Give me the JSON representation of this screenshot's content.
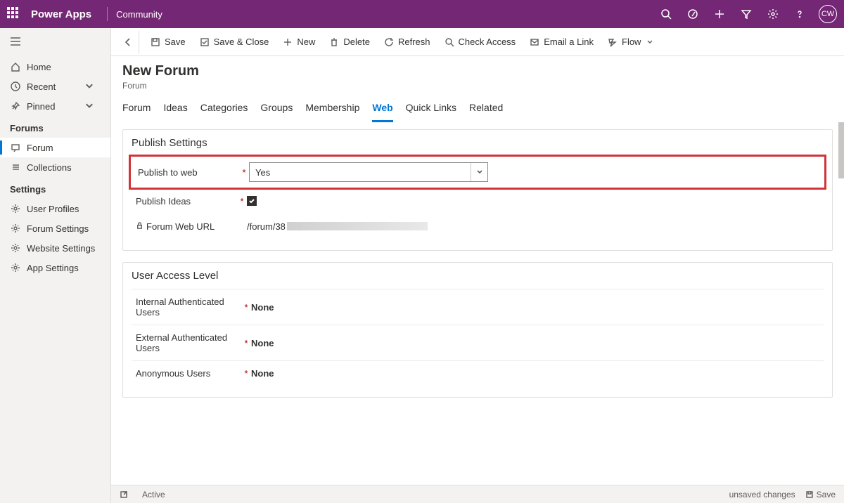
{
  "topbar": {
    "brand": "Power Apps",
    "environment": "Community",
    "avatar": "CW"
  },
  "sidebar": {
    "home": "Home",
    "recent": "Recent",
    "pinned": "Pinned",
    "group_forums": "Forums",
    "item_forum": "Forum",
    "item_collections": "Collections",
    "group_settings": "Settings",
    "item_user_profiles": "User Profiles",
    "item_forum_settings": "Forum Settings",
    "item_website_settings": "Website Settings",
    "item_app_settings": "App Settings"
  },
  "commands": {
    "save": "Save",
    "save_close": "Save & Close",
    "new": "New",
    "delete": "Delete",
    "refresh": "Refresh",
    "check_access": "Check Access",
    "email_link": "Email a Link",
    "flow": "Flow"
  },
  "page": {
    "title": "New Forum",
    "subtitle": "Forum"
  },
  "tabs": {
    "forum": "Forum",
    "ideas": "Ideas",
    "categories": "Categories",
    "groups": "Groups",
    "membership": "Membership",
    "web": "Web",
    "quick_links": "Quick Links",
    "related": "Related"
  },
  "publish": {
    "section_title": "Publish Settings",
    "publish_to_web_label": "Publish to web",
    "publish_to_web_value": "Yes",
    "publish_ideas_label": "Publish Ideas",
    "forum_web_url_label": "Forum Web URL",
    "forum_web_url_value": "/forum/38"
  },
  "access": {
    "section_title": "User Access Level",
    "internal_label": "Internal Authenticated Users",
    "internal_value": "None",
    "external_label": "External Authenticated Users",
    "external_value": "None",
    "anon_label": "Anonymous Users",
    "anon_value": "None"
  },
  "status": {
    "state": "Active",
    "unsaved": "unsaved changes",
    "save": "Save"
  }
}
